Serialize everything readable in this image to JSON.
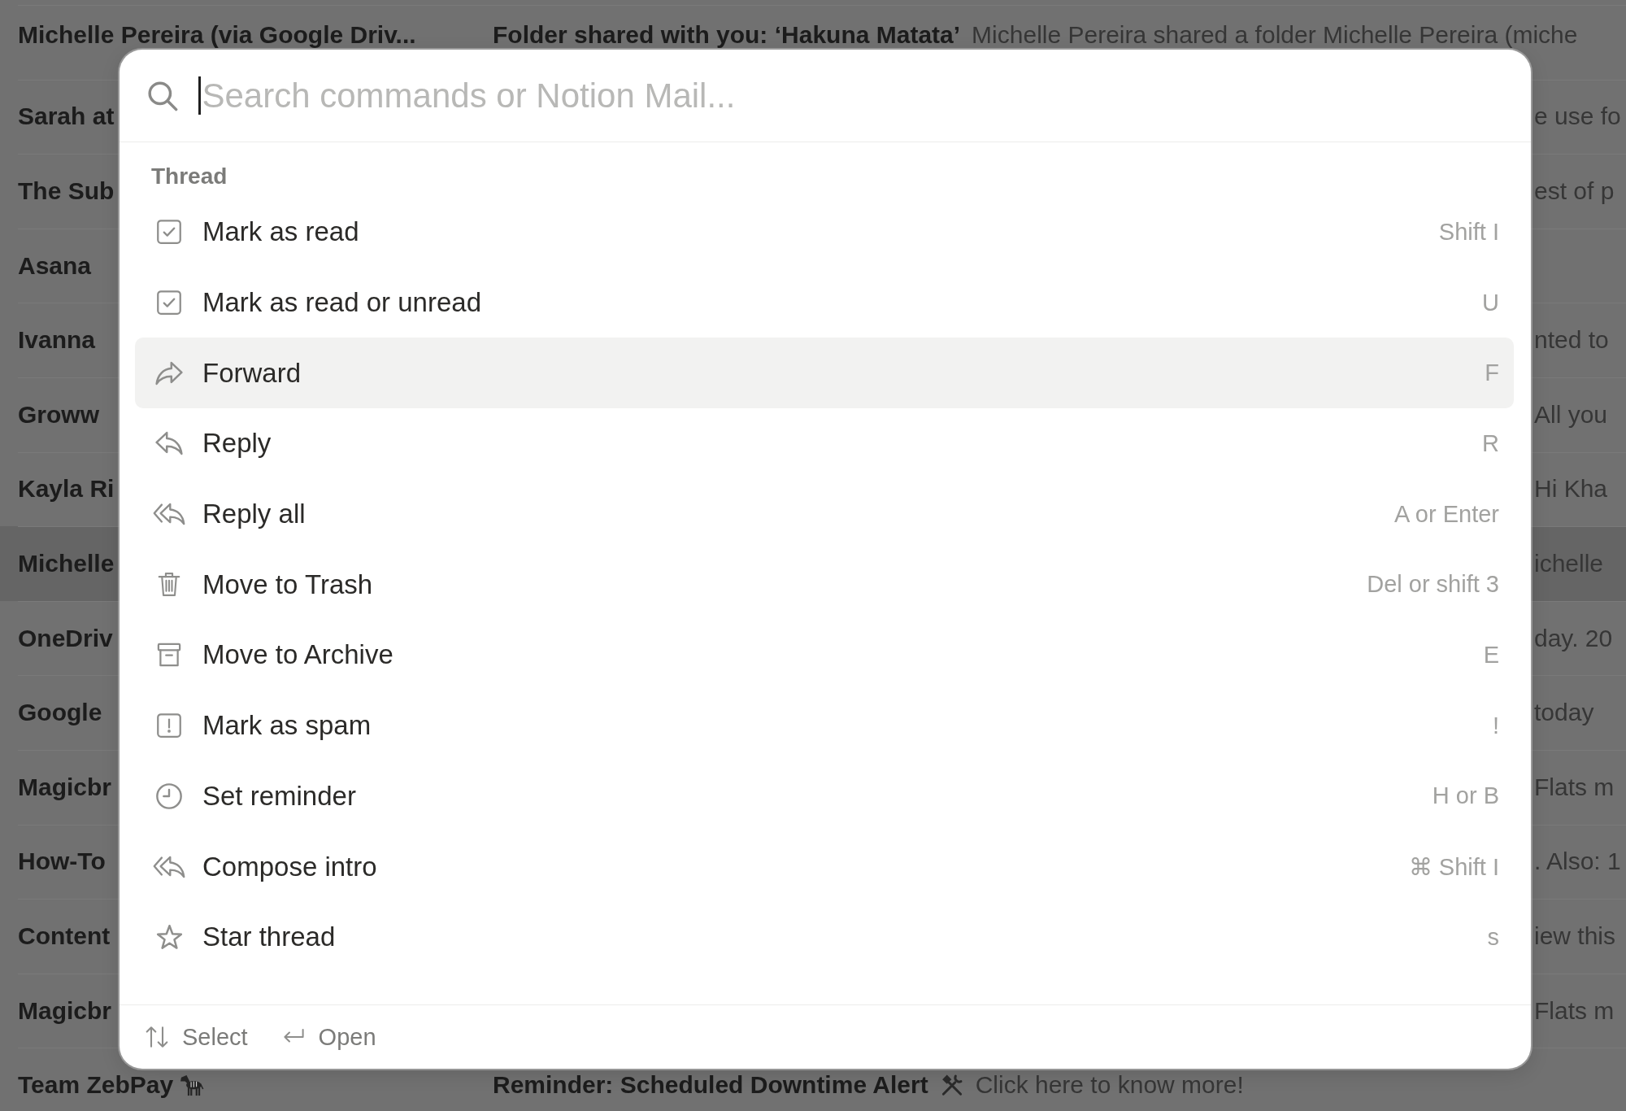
{
  "inbox": {
    "rows": [
      {
        "sender": "Michelle Pereira (via Google Driv...",
        "subject": "Folder shared with you: ‘Hakuna Matata’",
        "preview": "Michelle Pereira shared a folder Michelle Pereira (miche",
        "selected": false
      },
      {
        "sender": "Sarah at",
        "preview": "e use fo",
        "selected": false
      },
      {
        "sender": "The Sub",
        "preview": "est of p",
        "selected": false
      },
      {
        "sender": "Asana",
        "selected": false
      },
      {
        "sender": "Ivanna",
        "preview": "nted to",
        "selected": false
      },
      {
        "sender": "Groww",
        "preview": "All you",
        "selected": false
      },
      {
        "sender": "Kayla Ri",
        "preview": "Hi Kha",
        "selected": false
      },
      {
        "sender": "Michelle",
        "preview": "ichelle",
        "selected": true
      },
      {
        "sender": "OneDriv",
        "preview": "day. 20",
        "selected": false
      },
      {
        "sender": "Google",
        "preview": "today",
        "selected": false
      },
      {
        "sender": "Magicbr",
        "preview": "Flats m",
        "selected": false
      },
      {
        "sender": "How-To",
        "preview": ". Also: 1",
        "selected": false
      },
      {
        "sender": "Content",
        "preview": "iew this",
        "selected": false
      },
      {
        "sender": "Magicbr",
        "preview": "Flats m",
        "selected": false
      },
      {
        "sender": "Team ZebPay",
        "sender_emoji": true,
        "subject": "Reminder: Scheduled Downtime Alert",
        "subject_emoji": true,
        "preview": "Click here to know more!",
        "selected": false
      }
    ]
  },
  "command_palette": {
    "search": {
      "placeholder": "Search commands or Notion Mail...",
      "focused": true
    },
    "section": "Thread",
    "items": [
      {
        "label": "Mark as read",
        "shortcut": "Shift I",
        "kind": "read",
        "selected": false
      },
      {
        "label": "Mark as read or unread",
        "shortcut": "U",
        "kind": "read",
        "selected": false
      },
      {
        "label": "Forward",
        "shortcut": "F",
        "kind": "forward",
        "selected": true
      },
      {
        "label": "Reply",
        "shortcut": "R",
        "kind": "reply",
        "selected": false
      },
      {
        "label": "Reply all",
        "shortcut": "A or Enter",
        "kind": "replyall",
        "selected": false
      },
      {
        "label": "Move to Trash",
        "shortcut": "Del or shift 3",
        "kind": "trash",
        "selected": false
      },
      {
        "label": "Move to Archive",
        "shortcut": "E",
        "kind": "archive",
        "selected": false
      },
      {
        "label": "Mark as spam",
        "shortcut": "!",
        "kind": "spam",
        "selected": false
      },
      {
        "label": "Set reminder",
        "shortcut": "H or B",
        "kind": "reminder",
        "selected": false
      },
      {
        "label": "Compose intro",
        "shortcut": "⌘ Shift I",
        "kind": "replyall",
        "selected": false
      },
      {
        "label": "Star thread",
        "shortcut": "s",
        "kind": "star",
        "selected": false
      }
    ],
    "footer_hints": [
      {
        "label": "Select",
        "kind": "navigate"
      },
      {
        "label": "Open",
        "kind": "enter"
      }
    ]
  }
}
